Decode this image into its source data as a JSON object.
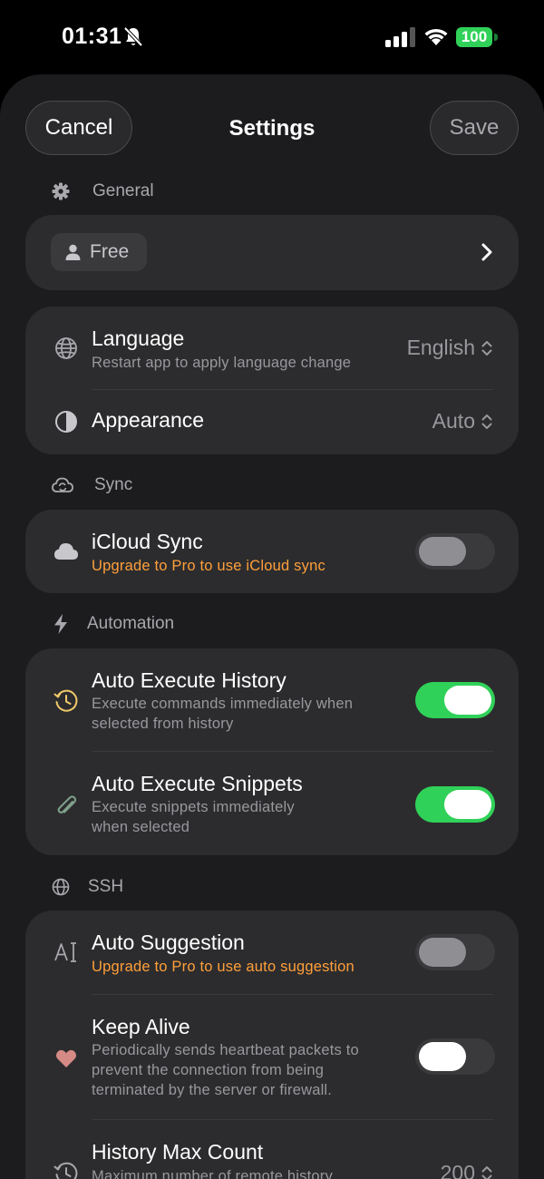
{
  "status_bar": {
    "time": "01:31",
    "battery": "100",
    "battery_color": "#30d158",
    "icons": [
      "bell-slash-icon",
      "cellular-signal-icon",
      "wifi-icon",
      "battery-icon"
    ]
  },
  "nav": {
    "cancel_label": "Cancel",
    "title": "Settings",
    "save_label": "Save"
  },
  "general": {
    "header": "General",
    "icon": "gear-icon",
    "account_plan": "Free",
    "account_icon": "person-icon",
    "language": {
      "title": "Language",
      "subtitle": "Restart app to apply language change",
      "value": "English",
      "icon": "globe-icon"
    },
    "appearance": {
      "title": "Appearance",
      "value": "Auto",
      "icon": "half-circle-icon"
    }
  },
  "sync": {
    "header": "Sync",
    "icon": "cloud-sync-icon",
    "icloud": {
      "title": "iCloud Sync",
      "subtitle": "Upgrade to Pro to use iCloud sync",
      "enabled": false,
      "icon": "cloud-icon"
    }
  },
  "automation": {
    "header": "Automation",
    "icon": "bolt-icon",
    "history": {
      "title": "Auto Execute History",
      "subtitle_line1": "Execute commands immediately when",
      "subtitle_line2": "selected from history",
      "enabled": true,
      "icon": "clock-history-icon"
    },
    "snippets": {
      "title": "Auto Execute Snippets",
      "subtitle_line1": "Execute snippets immediately",
      "subtitle_line2": "when selected",
      "enabled": true,
      "icon": "paperclip-icon"
    }
  },
  "ssh": {
    "header": "SSH",
    "icon": "globe-icon",
    "suggestion": {
      "title": "Auto Suggestion",
      "subtitle": "Upgrade to Pro to use auto suggestion",
      "enabled": false,
      "icon": "text-cursor-icon"
    },
    "keep_alive": {
      "title": "Keep Alive",
      "subtitle_line1": "Periodically sends heartbeat packets to",
      "subtitle_line2": "prevent the connection from being",
      "subtitle_line3": "terminated by the server or firewall.",
      "enabled": false,
      "icon": "heart-icon"
    },
    "history_max": {
      "title": "History Max Count",
      "subtitle": "Maximum number of remote history",
      "value": "200",
      "icon": "clock-history-icon"
    }
  },
  "colors": {
    "accent_green": "#30d158",
    "warning_orange": "#ff9f3a",
    "card_bg": "#2c2c2e",
    "sheet_bg": "#1c1c1e"
  }
}
